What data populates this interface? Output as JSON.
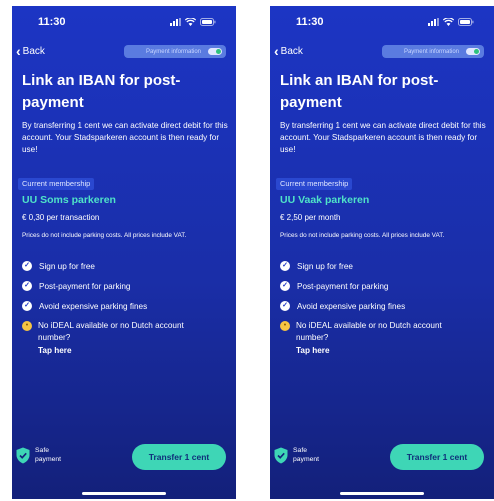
{
  "screens": [
    {
      "status_time": "11:30",
      "back_label": "Back",
      "info_pill_label": "Payment information",
      "title": "Link an IBAN for post-payment",
      "intro": "By transferring 1 cent we can activate direct debit for this account. Your Stadsparkeren account is then ready for use!",
      "membership_tag": "Current membership",
      "plan_name": "UU Soms parkeren",
      "plan_price": "€ 0,30 per transaction",
      "vat_note": "Prices do not include parking costs. All prices include VAT.",
      "features": [
        "Sign up for free",
        "Post-payment for parking",
        "Avoid expensive parking fines"
      ],
      "ideal_text": "No iDEAL available or no Dutch account number?",
      "tap_here": "Tap here",
      "safe_label_1": "Safe",
      "safe_label_2": "payment",
      "transfer_label": "Transfer 1 cent"
    },
    {
      "status_time": "11:30",
      "back_label": "Back",
      "info_pill_label": "Payment information",
      "title": "Link an IBAN for post-payment",
      "intro": "By transferring 1 cent we can activate direct debit for this account. Your Stadsparkeren account is then ready for use!",
      "membership_tag": "Current membership",
      "plan_name": "UU Vaak parkeren",
      "plan_price": "€ 2,50 per month",
      "vat_note": "Prices do not include parking costs. All prices include VAT.",
      "features": [
        "Sign up for free",
        "Post-payment for parking",
        "Avoid expensive parking fines"
      ],
      "ideal_text": "No iDEAL available or no Dutch account number?",
      "tap_here": "Tap here",
      "safe_label_1": "Safe",
      "safe_label_2": "payment",
      "transfer_label": "Transfer 1 cent"
    }
  ],
  "colors": {
    "accent": "#3ed6b6",
    "plan_name": "#4fe3c8",
    "background_top": "#1c35c4",
    "background_bottom": "#13207a"
  },
  "icons": [
    "signal-icon",
    "wifi-icon",
    "battery-icon",
    "back-chevron-icon",
    "check-icon",
    "thinking-emoji-icon",
    "shield-check-icon"
  ]
}
